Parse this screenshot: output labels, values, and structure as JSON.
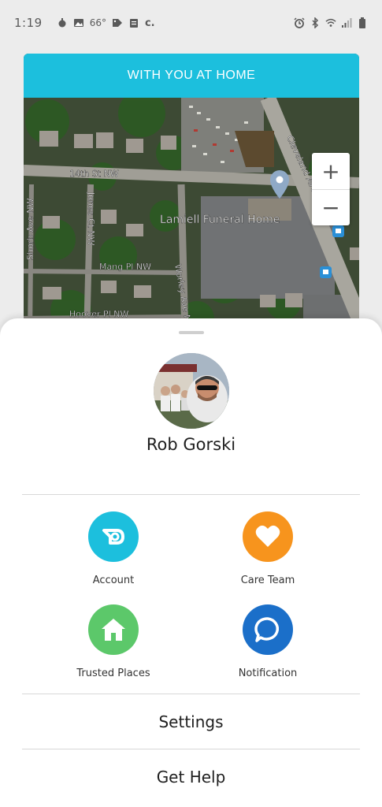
{
  "status_bar": {
    "time": "1:19",
    "temperature": "66°",
    "carrier_glyph": "c."
  },
  "card": {
    "title": "WITH YOU AT HOME"
  },
  "map": {
    "place_label": "Lamiell Funeral Home",
    "streets": {
      "st_14th": "14th St NW",
      "jones": "Jones Ct NW",
      "shorb": "Shorb Ave NW",
      "mang": "Mang Pl NW",
      "worley": "Worley Ave NW",
      "hoover": "Hoover Pl NW",
      "cleveland": "Cleveland Ave NW"
    },
    "zoom_in_label": "+",
    "zoom_out_label": "−"
  },
  "profile": {
    "name": "Rob Gorski"
  },
  "tiles": [
    {
      "label": "Account",
      "color": "#1cbfdd",
      "icon": "account-icon"
    },
    {
      "label": "Care Team",
      "color": "#f7941d",
      "icon": "heart-icon"
    },
    {
      "label": "Trusted Places",
      "color": "#5cc86a",
      "icon": "home-icon"
    },
    {
      "label": "Notification",
      "color": "#1b6fc9",
      "icon": "chat-bubble-icon"
    }
  ],
  "menu": {
    "settings": "Settings",
    "get_help": "Get Help"
  }
}
